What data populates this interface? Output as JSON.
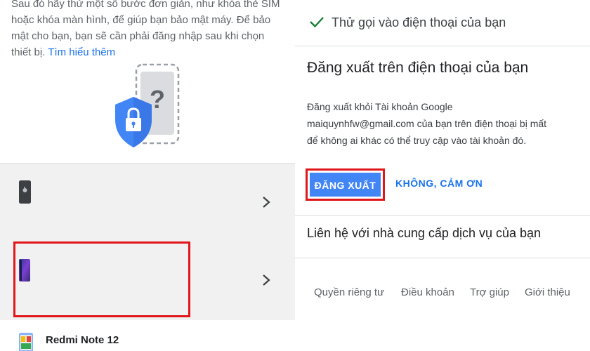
{
  "left": {
    "intro_lines": [
      "Sau đó hãy thử một số bước đơn giản, như khóa thẻ SIM",
      "hoặc khóa màn hình, để giúp bạn bảo mật máy. Để bảo",
      "mật cho bạn, bạn sẽ cần phải đăng nhập sau khi chọn"
    ],
    "intro_last": "thiết bị.",
    "learn_more": "Tìm hiểu thêm",
    "illustration_icon": "shield-lock-phone-question-icon",
    "devices": [
      {
        "icon": "iphone-icon"
      },
      {
        "icon": "android-phone-icon"
      },
      {
        "icon": "redmi-phone-icon",
        "label": "Redmi Note 12"
      }
    ]
  },
  "right": {
    "call_label": "Thử gọi vào điện thoại của bạn",
    "signout_title": "Đăng xuất trên điện thoại của bạn",
    "signout_desc": [
      "Đăng xuất khỏi Tài khoản Google",
      "maiquynhfw@gmail.com của bạn trên điện thoại bị mất",
      "để không ai khác có thể truy cập vào tài khoản đó."
    ],
    "signout_button": "ĐĂNG XUẤT",
    "no_thanks_button": "KHÔNG, CẢM ƠN",
    "contact_label": "Liên hệ với nhà cung cấp dịch vụ của bạn",
    "footer": {
      "privacy": "Quyền riêng tư",
      "terms": "Điều khoản",
      "help": "Trợ giúp",
      "about": "Giới thiệu"
    }
  },
  "colors": {
    "accent": "#1a73e8",
    "button_bg": "#4285f4",
    "highlight": "#e0161b",
    "check": "#188038"
  }
}
